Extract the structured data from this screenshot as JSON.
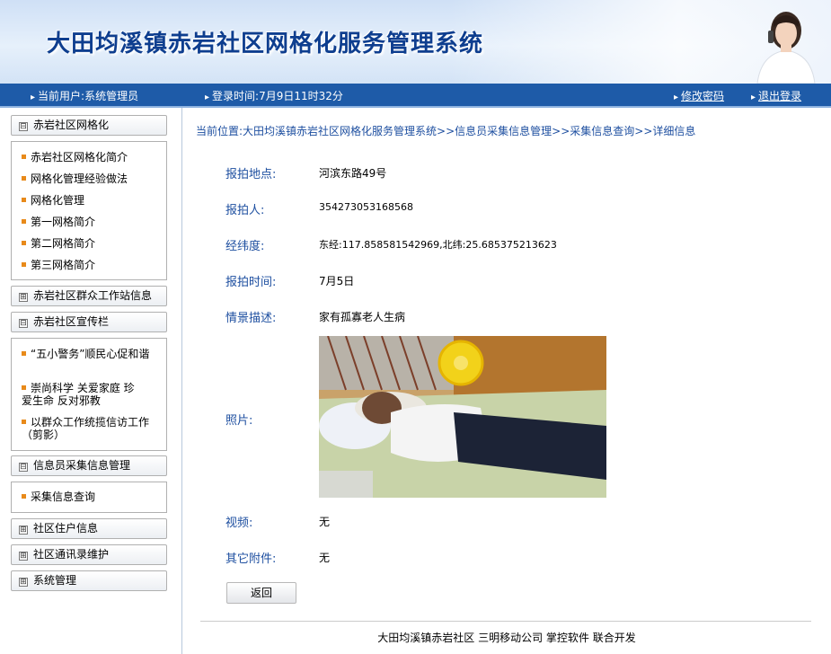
{
  "app": {
    "title": "大田均溪镇赤岩社区网格化服务管理系统"
  },
  "navbar": {
    "current_user": "当前用户:系统管理员",
    "login_time": "登录时间:7月9日11时32分",
    "change_password": "修改密码",
    "logout": "退出登录"
  },
  "sidebar": {
    "sections": [
      {
        "title": "赤岩社区网格化",
        "state": "expanded",
        "items": [
          "赤岩社区网格化简介",
          "网格化管理经验做法",
          "网格化管理",
          "第一网格简介",
          "第二网格简介",
          "第三网格简介"
        ]
      },
      {
        "title": "赤岩社区群众工作站信息",
        "state": "collapsed"
      },
      {
        "title": "赤岩社区宣传栏",
        "state": "expanded",
        "items": [
          "“五小警务”顺民心促和谐",
          "崇尚科学 关爱家庭 珍爱生命 反对邪教",
          "以群众工作统揽信访工作（剪影）"
        ]
      },
      {
        "title": "信息员采集信息管理",
        "state": "expanded",
        "items": [
          "采集信息查询"
        ]
      },
      {
        "title": "社区住户信息",
        "state": "collapsed"
      },
      {
        "title": "社区通讯录维护",
        "state": "collapsed"
      },
      {
        "title": "系统管理",
        "state": "collapsed"
      }
    ],
    "expand_glyph": "⊞",
    "collapse_glyph": "⊟"
  },
  "breadcrumb": "当前位置:大田均溪镇赤岩社区网格化服务管理系统>>信息员采集信息管理>>采集信息查询>>详细信息",
  "detail": {
    "location_label": "报拍地点:",
    "location_value": "河滨东路49号",
    "reporter_label": "报拍人:",
    "reporter_value": "354273053168568",
    "coords_label": "经纬度:",
    "coords_value": "东经:117.858581542969,北纬:25.685375213623",
    "time_label": "报拍时间:",
    "time_value": "7月5日",
    "desc_label": "情景描述:",
    "desc_value": "家有孤寡老人生病",
    "photo_label": "照片:",
    "video_label": "视频:",
    "video_value": "无",
    "attach_label": "其它附件:",
    "attach_value": "无"
  },
  "buttons": {
    "back": "返回"
  },
  "footer": "大田均溪镇赤岩社区 三明移动公司 掌控软件 联合开发",
  "colors": {
    "nav_bar": "#1e5ba8",
    "title_text": "#0e3e8f",
    "label_text": "#1e4fa0",
    "bullet": "#e88a1a"
  }
}
